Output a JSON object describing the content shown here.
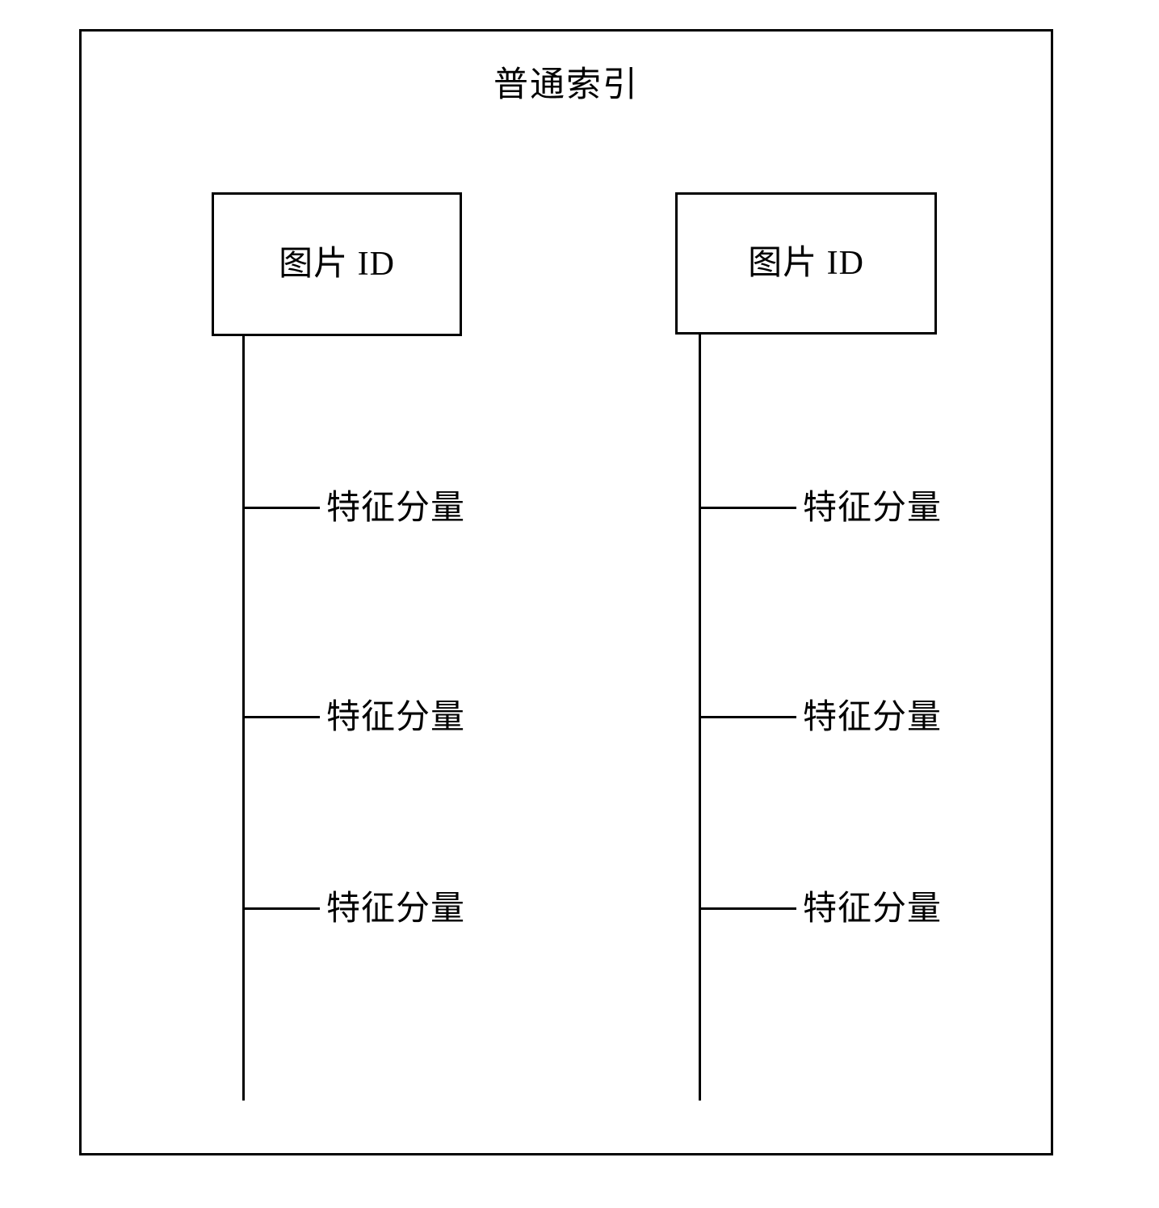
{
  "figure": {
    "title": "普通索引",
    "background_color": "#ffffff",
    "line_color": "#000000"
  },
  "columns": [
    {
      "id": "left",
      "box_label": "图片 ID",
      "branches": [
        {
          "label": "特征分量"
        },
        {
          "label": "特征分量"
        },
        {
          "label": "特征分量"
        }
      ]
    },
    {
      "id": "right",
      "box_label": "图片 ID",
      "branches": [
        {
          "label": "特征分量"
        },
        {
          "label": "特征分量"
        },
        {
          "label": "特征分量"
        }
      ]
    }
  ]
}
